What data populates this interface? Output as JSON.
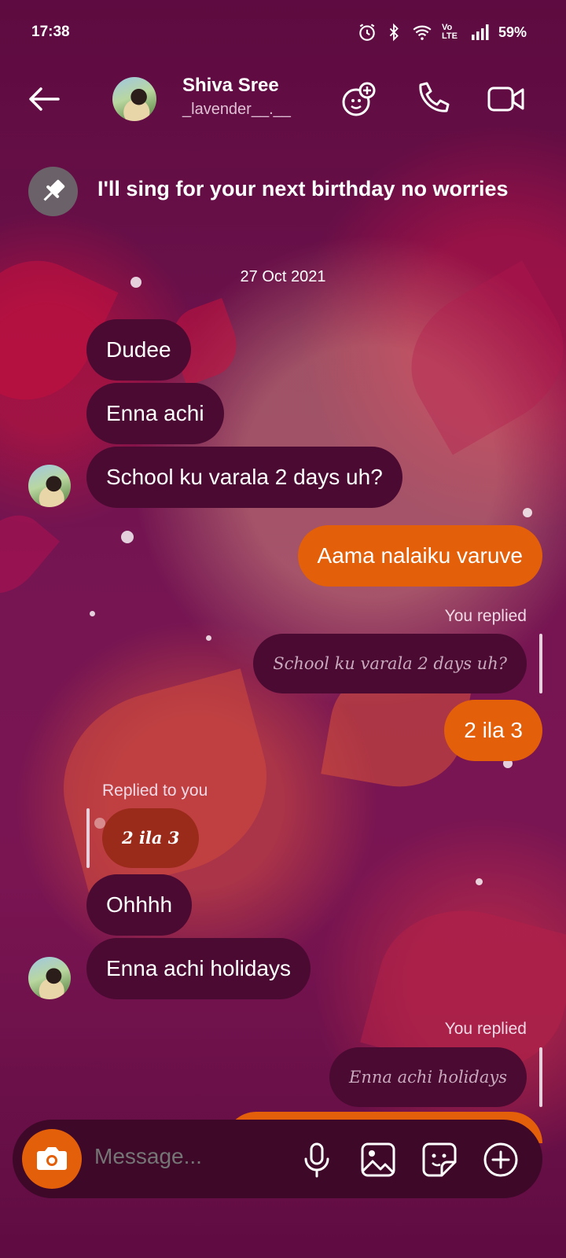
{
  "status_bar": {
    "time": "17:38",
    "network": "Vo LTE",
    "battery": "59%"
  },
  "header": {
    "name": "Shiva Sree",
    "handle": "_lavender__.__"
  },
  "pinned": {
    "text": "I'll sing for your next birthday no worries"
  },
  "date_separator": "27 Oct 2021",
  "messages": {
    "m1": "Dudee",
    "m2": "Enna achi",
    "m3": "School ku varala 2 days uh?",
    "m4": "Aama nalaiku varuve",
    "reply1_label": "You replied",
    "reply1_quote": "School ku varala 2 days uh?",
    "m5": "2 ila 3",
    "reply2_label": "Replied to you",
    "reply2_quote": "2 ila 3",
    "m6": "Ohhhh",
    "m7": "Enna achi holidays",
    "reply3_label": "You replied",
    "reply3_quote": "Enna achi holidays"
  },
  "composer": {
    "placeholder": "Message..."
  },
  "colors": {
    "accent": "#e35f09",
    "incoming_bubble": "#4a0a32",
    "background": "#6a0f4a"
  }
}
